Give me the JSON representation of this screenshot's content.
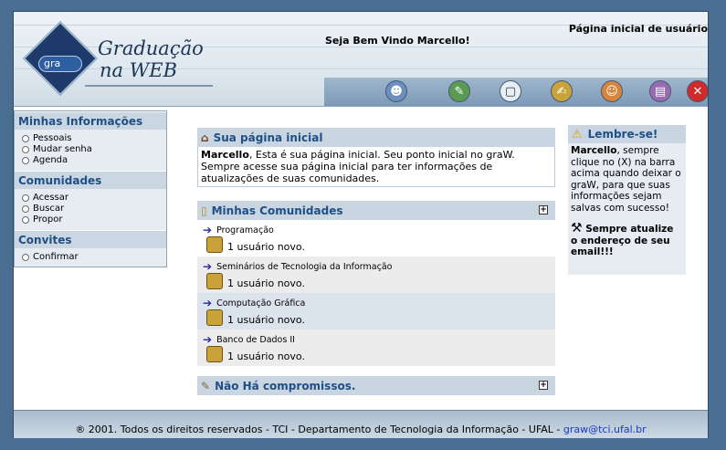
{
  "header": {
    "logo_badge": "gra",
    "logo_line1": "Graduação",
    "logo_line2": "na WEB",
    "welcome": "Seja Bem Vindo Marcello!",
    "page_heading": "Página inicial de usuário",
    "toolbar_icons": [
      "users-icon",
      "edit-user-icon",
      "window-icon",
      "notes-icon",
      "person-icon",
      "book-icon",
      "close-icon"
    ]
  },
  "sidebar": {
    "sections": [
      {
        "title": "Minhas Informações",
        "items": [
          "Pessoais",
          "Mudar senha",
          "Agenda"
        ]
      },
      {
        "title": "Comunidades",
        "items": [
          "Acessar",
          "Buscar",
          "Propor"
        ]
      },
      {
        "title": "Convites",
        "items": [
          "Confirmar"
        ]
      }
    ]
  },
  "home": {
    "title": "Sua página inicial",
    "user": "Marcello",
    "text": ", Esta é sua página inicial. Seu ponto inicial no graW. Sempre acesse sua página inicial para ter informações de atualizações de suas comunidades."
  },
  "communities": {
    "title": "Minhas Comunidades",
    "expand": "+",
    "items": [
      {
        "name": "Programação",
        "news": "1 usuário novo."
      },
      {
        "name": "Seminários de Tecnologia da Informação",
        "news": "1 usuário novo."
      },
      {
        "name": "Computação Gráfica",
        "news": "1 usuário novo."
      },
      {
        "name": "Banco de Dados II",
        "news": "1 usuário novo."
      }
    ]
  },
  "agenda": {
    "title": "Não Há compromissos.",
    "expand": "+"
  },
  "reminder": {
    "title": "Lembre-se!",
    "user": "Marcello",
    "text": ", sempre clique no (X) na barra acima quando deixar o graW, para que suas informações sejam salvas com sucesso!",
    "tip": "Sempre atualize o endereço de seu email!!!"
  },
  "footer": {
    "text": "® 2001. Todos os direitos reservados - TCI - Departamento de Tecnologia da Informação - UFAL - ",
    "email": "graw@tci.ufal.br"
  },
  "colors": {
    "background": "#4a6d92",
    "panel_header": "#c9d6e2",
    "accent_text": "#1f4f84",
    "link": "#1a38c8"
  }
}
